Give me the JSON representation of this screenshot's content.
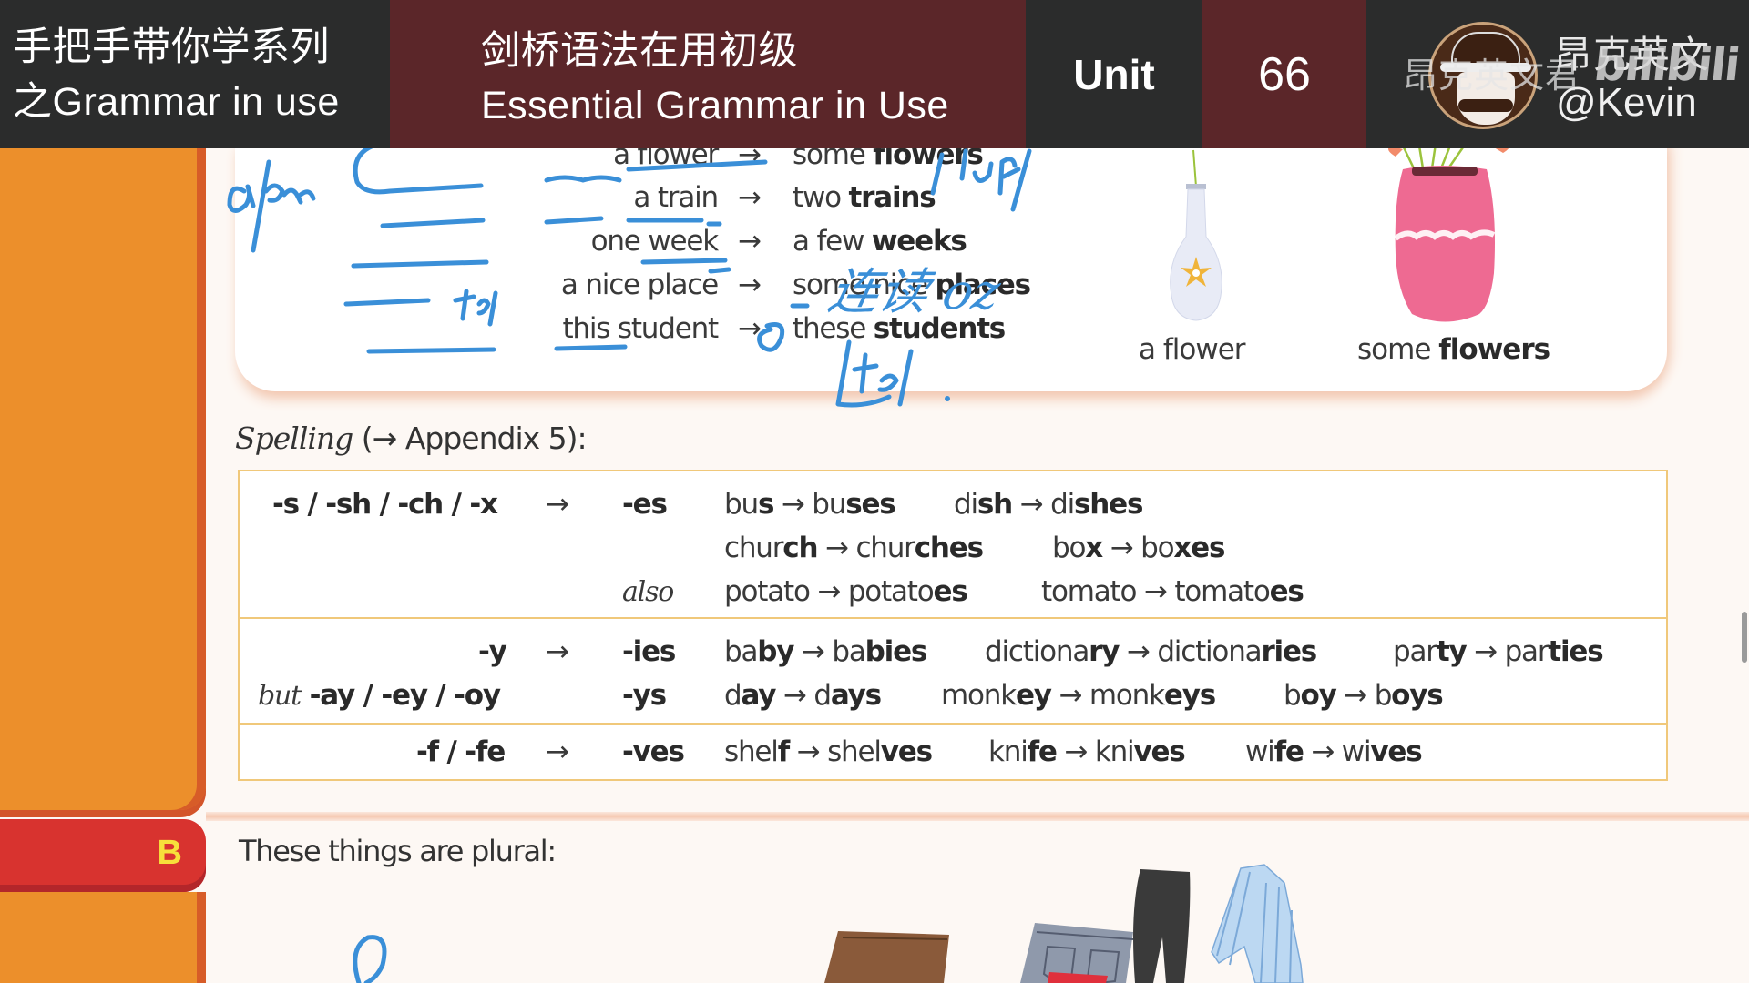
{
  "header": {
    "series_line1": "手把手带你学系列",
    "series_line2": "之Grammar in use",
    "book_line1": "剑桥语法在用初级",
    "book_line2": "Essential Grammar in Use",
    "unit_label": "Unit",
    "unit_number": "66",
    "brand_name_cn": "昂克英文",
    "brand_handle": "@Kevin",
    "watermark_cn": "昂克英文君",
    "watermark_platform": "bilibili"
  },
  "colors": {
    "header_dark": "#2b2c2c",
    "header_maroon": "#5b2629",
    "tab_orange": "#ec8f2b",
    "tab_red": "#d8332f",
    "tab_letter_yellow": "#f7df3b",
    "table_border": "#f0c87a",
    "ink_blue": "#3a8fd8"
  },
  "examples": [
    {
      "singular": "a flower",
      "arrow": "→",
      "plural_prefix": "some ",
      "plural_bold": "flowers"
    },
    {
      "singular": "a train",
      "arrow": "→",
      "plural_prefix": "two ",
      "plural_bold": "trains"
    },
    {
      "singular": "one week",
      "arrow": "→",
      "plural_prefix": "a few ",
      "plural_bold": "weeks"
    },
    {
      "singular": "a nice place",
      "arrow": "→",
      "plural_prefix": "some nice ",
      "plural_bold": "places"
    },
    {
      "singular": "this student",
      "arrow": "→",
      "plural_prefix": "these ",
      "plural_bold": "students"
    }
  ],
  "illustration": {
    "caption_single": "a flower",
    "caption_plural_prefix": "some ",
    "caption_plural_bold": "flowers"
  },
  "annotations": {
    "a_an": "a/an",
    "phonetic_1": "/flʊə/",
    "note_cn": "连读 oz",
    "phonetic_2": "/ts/.",
    "phonetic_3": "/s/"
  },
  "spelling": {
    "heading_italic": "Spelling",
    "heading_rest": " (→ Appendix 5):",
    "rows": [
      {
        "rule": "-s / -sh / -ch / -x",
        "arrow": "→",
        "ending": "-es",
        "lines": [
          {
            "prefix": "",
            "items": [
              {
                "base": "bu",
                "base_bold": "s",
                "plural": "bu",
                "plural_bold": "ses"
              },
              {
                "base": "di",
                "base_bold": "sh",
                "plural": "di",
                "plural_bold": "shes"
              }
            ]
          },
          {
            "prefix": "",
            "items": [
              {
                "base": "chur",
                "base_bold": "ch",
                "plural": "chur",
                "plural_bold": "ches"
              },
              {
                "base": "bo",
                "base_bold": "x",
                "plural": "bo",
                "plural_bold": "xes"
              }
            ]
          },
          {
            "prefix": "also",
            "items": [
              {
                "base": "potato",
                "base_bold": "",
                "plural": "potato",
                "plural_bold": "es"
              },
              {
                "base": "tomato",
                "base_bold": "",
                "plural": "tomato",
                "plural_bold": "es"
              }
            ]
          }
        ]
      },
      {
        "rule": "-y",
        "arrow": "→",
        "ending": "-ies",
        "items": [
          {
            "base": "ba",
            "base_bold": "by",
            "plural": "ba",
            "plural_bold": "bies"
          },
          {
            "base": "dictiona",
            "base_bold": "ry",
            "plural": "dictiona",
            "plural_bold": "ries"
          },
          {
            "base": "par",
            "base_bold": "ty",
            "plural": "par",
            "plural_bold": "ties"
          }
        ],
        "sub_rule_italic": "but",
        "sub_rule": " -ay / -ey / -oy",
        "sub_ending": "-ys",
        "sub_items": [
          {
            "base": "d",
            "base_bold": "ay",
            "plural": "d",
            "plural_bold": "ays"
          },
          {
            "base": "monk",
            "base_bold": "ey",
            "plural": "monk",
            "plural_bold": "eys"
          },
          {
            "base": "b",
            "base_bold": "oy",
            "plural": "b",
            "plural_bold": "oys"
          }
        ]
      },
      {
        "rule": "-f / -fe",
        "arrow": "→",
        "ending": "-ves",
        "items": [
          {
            "base": "shel",
            "base_bold": "f",
            "plural": "shel",
            "plural_bold": "ves"
          },
          {
            "base": "kni",
            "base_bold": "fe",
            "plural": "kni",
            "plural_bold": "ves"
          },
          {
            "base": "wi",
            "base_bold": "fe",
            "plural": "wi",
            "plural_bold": "ves"
          }
        ]
      }
    ]
  },
  "section_b": {
    "letter": "B",
    "intro": "These things are plural:"
  }
}
